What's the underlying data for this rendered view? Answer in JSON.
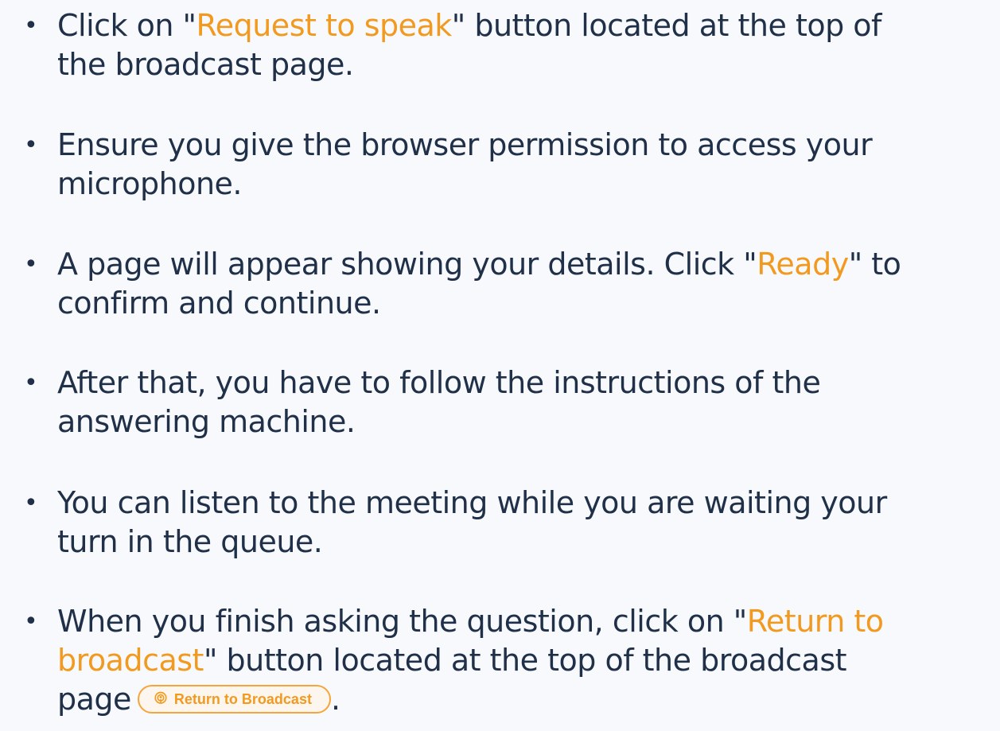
{
  "steps": [
    {
      "lines": [
        [
          {
            "text": "Click on \"",
            "hl": false
          },
          {
            "text": "Request to speak",
            "hl": true
          },
          {
            "text": "\" button located at the top of",
            "hl": false
          }
        ],
        [
          {
            "text": "the broadcast page.",
            "hl": false
          }
        ]
      ]
    },
    {
      "lines": [
        [
          {
            "text": "Ensure you give the browser permission to access your",
            "hl": false
          }
        ],
        [
          {
            "text": "microphone.",
            "hl": false
          }
        ]
      ]
    },
    {
      "lines": [
        [
          {
            "text": "A page will appear showing your details. Click \"",
            "hl": false
          },
          {
            "text": "Ready",
            "hl": true
          },
          {
            "text": "\" to",
            "hl": false
          }
        ],
        [
          {
            "text": "confirm and continue.",
            "hl": false
          }
        ]
      ]
    },
    {
      "lines": [
        [
          {
            "text": "After that, you have to follow the instructions of the",
            "hl": false
          }
        ],
        [
          {
            "text": "answering machine.",
            "hl": false
          }
        ]
      ]
    },
    {
      "lines": [
        [
          {
            "text": "You can listen to the meeting while you are waiting your",
            "hl": false
          }
        ],
        [
          {
            "text": "turn in the queue.",
            "hl": false
          }
        ]
      ]
    },
    {
      "lines": [
        [
          {
            "text": "When you finish asking the question, click on \"",
            "hl": false
          },
          {
            "text": "Return to",
            "hl": true
          }
        ],
        [
          {
            "text": "broadcast",
            "hl": true
          },
          {
            "text": "\" button located at the top of the broadcast",
            "hl": false
          }
        ],
        [
          {
            "text": "page",
            "hl": false
          },
          {
            "button": "return_to_broadcast"
          },
          {
            "text": ".",
            "hl": false
          }
        ]
      ]
    }
  ],
  "bullet_char": "•",
  "return_button": {
    "label": "Return to Broadcast",
    "icon": "podcast-icon"
  },
  "colors": {
    "background": "#f7f9fc",
    "text": "#1f3048",
    "accent": "#f29a1f",
    "button_border": "#f6a53a"
  }
}
